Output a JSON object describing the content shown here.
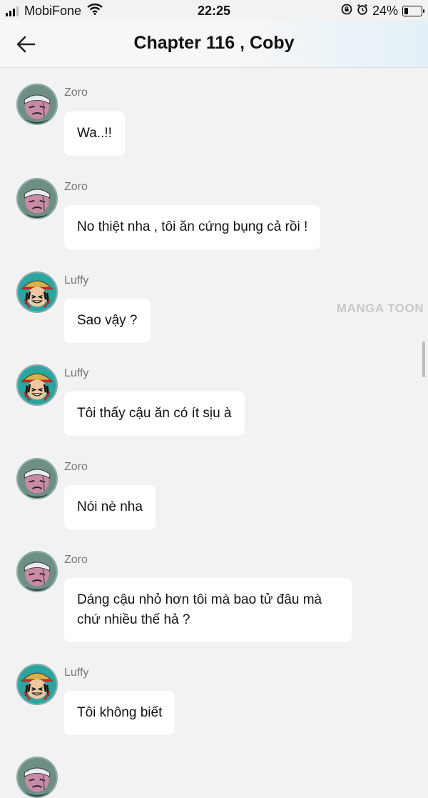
{
  "status_bar": {
    "carrier": "MobiFone",
    "time": "22:25",
    "battery": "24%"
  },
  "header": {
    "title": "Chapter 116 , Coby"
  },
  "watermark": "MANGA TOON",
  "messages": [
    {
      "name": "Zoro",
      "text": "Wa..!!"
    },
    {
      "name": "Zoro",
      "text": "No thiệt nha , tôi ăn cứng bụng cả rồi !"
    },
    {
      "name": "Luffy",
      "text": "Sao vậy ?"
    },
    {
      "name": "Luffy",
      "text": "Tôi thấy cậu ăn có ít sịu à"
    },
    {
      "name": "Zoro",
      "text": "Nói nè nha"
    },
    {
      "name": "Zoro",
      "text_line1": "Dáng cậu nhỏ hơn tôi mà bao tử đâu mà",
      "text_line2": "chứ nhiều thế hả ?"
    },
    {
      "name": "Luffy",
      "text": "Tôi không biết"
    }
  ],
  "icons": {
    "back": "arrow-left-icon",
    "signal": "cellular-signal-icon",
    "wifi": "wifi-icon",
    "lock": "rotation-lock-icon",
    "alarm": "alarm-icon",
    "battery": "battery-icon"
  }
}
